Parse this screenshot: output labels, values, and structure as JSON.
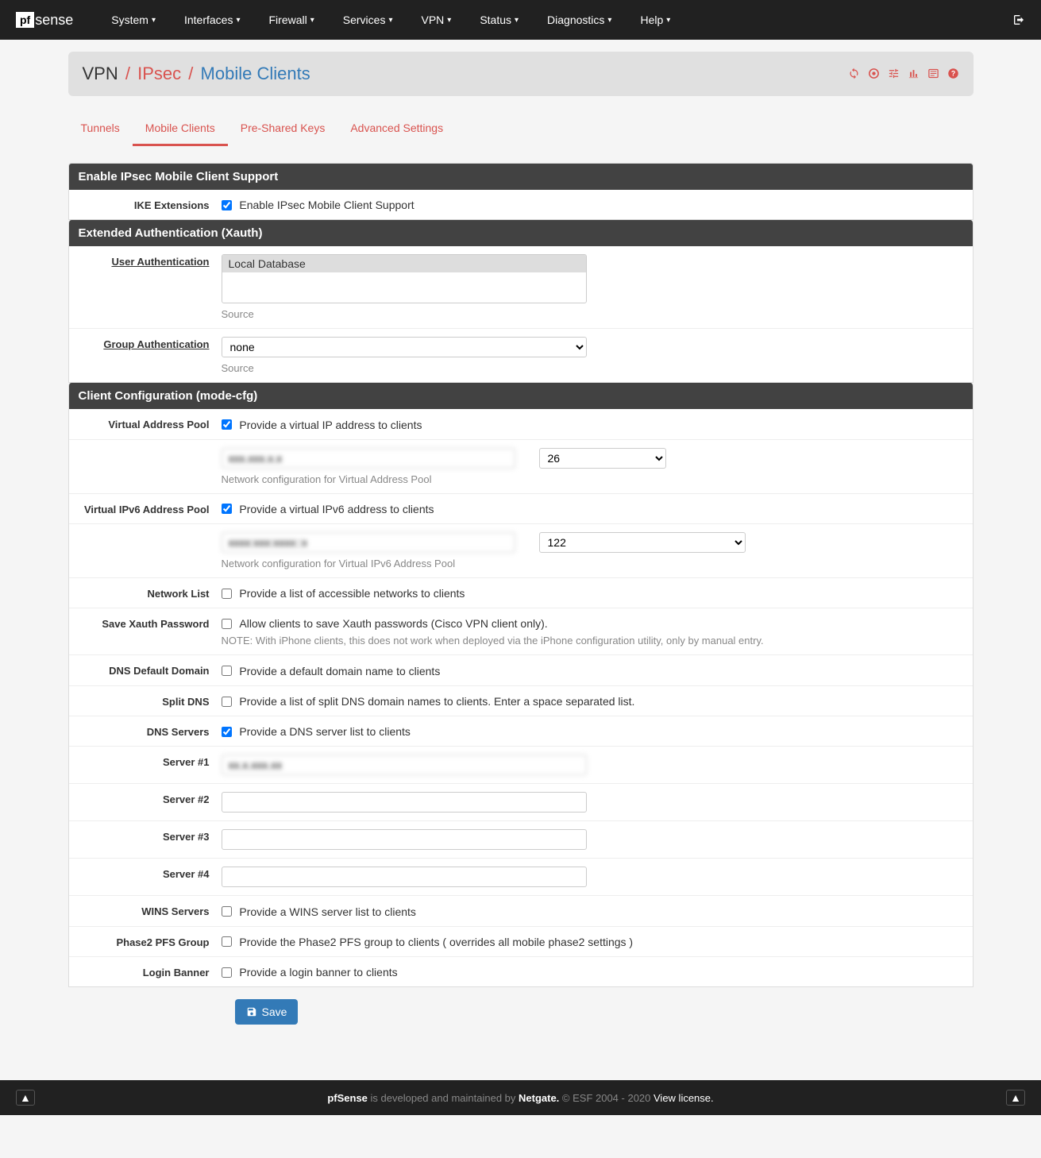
{
  "nav": {
    "logo_prefix": "pf",
    "logo_suffix": "sense",
    "items": [
      "System",
      "Interfaces",
      "Firewall",
      "Services",
      "VPN",
      "Status",
      "Diagnostics",
      "Help"
    ]
  },
  "breadcrumb": {
    "root": "VPN",
    "mid": "IPsec",
    "current": "Mobile Clients"
  },
  "tabs": [
    "Tunnels",
    "Mobile Clients",
    "Pre-Shared Keys",
    "Advanced Settings"
  ],
  "active_tab": "Mobile Clients",
  "panels": {
    "enable": {
      "title": "Enable IPsec Mobile Client Support",
      "ike_label": "IKE Extensions",
      "ike_text": "Enable IPsec Mobile Client Support"
    },
    "xauth": {
      "title": "Extended Authentication (Xauth)",
      "user_auth_label": "User Authentication",
      "user_auth_option": "Local Database",
      "source_text": "Source",
      "group_auth_label": "Group Authentication",
      "group_auth_value": "none"
    },
    "client": {
      "title": "Client Configuration (mode-cfg)",
      "vap_label": "Virtual Address Pool",
      "vap_text": "Provide a virtual IP address to clients",
      "vap_mask": "26",
      "vap_help": "Network configuration for Virtual Address Pool",
      "vap6_label": "Virtual IPv6 Address Pool",
      "vap6_text": "Provide a virtual IPv6 address to clients",
      "vap6_mask": "122",
      "vap6_help": "Network configuration for Virtual IPv6 Address Pool",
      "netlist_label": "Network List",
      "netlist_text": "Provide a list of accessible networks to clients",
      "xauth_label": "Save Xauth Password",
      "xauth_text": "Allow clients to save Xauth passwords (Cisco VPN client only).",
      "xauth_note": "NOTE: With iPhone clients, this does not work when deployed via the iPhone configuration utility, only by manual entry.",
      "dns_domain_label": "DNS Default Domain",
      "dns_domain_text": "Provide a default domain name to clients",
      "split_dns_label": "Split DNS",
      "split_dns_text": "Provide a list of split DNS domain names to clients. Enter a space separated list.",
      "dns_servers_label": "DNS Servers",
      "dns_servers_text": "Provide a DNS server list to clients",
      "server1_label": "Server #1",
      "server2_label": "Server #2",
      "server3_label": "Server #3",
      "server4_label": "Server #4",
      "wins_label": "WINS Servers",
      "wins_text": "Provide a WINS server list to clients",
      "pfs_label": "Phase2 PFS Group",
      "pfs_text": "Provide the Phase2 PFS group to clients ( overrides all mobile phase2 settings )",
      "banner_label": "Login Banner",
      "banner_text": "Provide a login banner to clients"
    }
  },
  "save_button": "Save",
  "footer": {
    "p1": "pfSense",
    "p2": " is developed and maintained by ",
    "p3": "Netgate.",
    "p4": " © ESF 2004 - 2020 ",
    "p5": "View license."
  }
}
